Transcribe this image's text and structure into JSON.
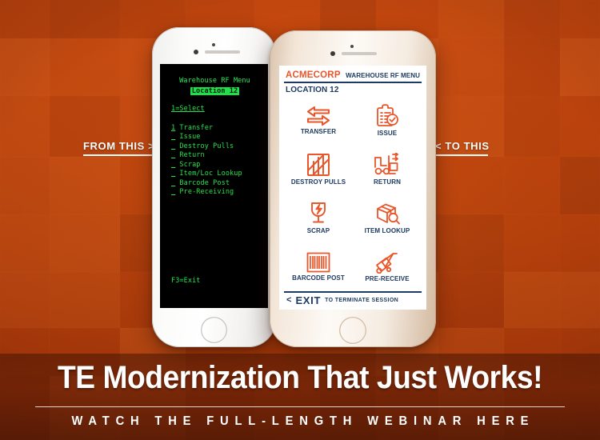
{
  "labels": {
    "from_this": "FROM THIS  >",
    "to_this": "<  TO THIS"
  },
  "legacy_terminal": {
    "title": "Warehouse RF Menu",
    "location": "Location 12",
    "prompt": "1=Select",
    "items": [
      {
        "key": "1",
        "label": "Transfer"
      },
      {
        "key": "_",
        "label": "Issue"
      },
      {
        "key": "_",
        "label": "Destroy Pulls"
      },
      {
        "key": "_",
        "label": "Return"
      },
      {
        "key": "_",
        "label": "Scrap"
      },
      {
        "key": "_",
        "label": "Item/Loc Lookup"
      },
      {
        "key": "_",
        "label": "Barcode Post"
      },
      {
        "key": "_",
        "label": "Pre-Receiving"
      }
    ],
    "exit": "F3=Exit",
    "text_color": "#24e24a",
    "background_color": "#000000"
  },
  "modern_app": {
    "brand": "ACMECORP",
    "header_title": "WAREHOUSE RF MENU",
    "location": "LOCATION 12",
    "tiles": [
      {
        "label": "TRANSFER",
        "icon": "transfer-arrows-icon"
      },
      {
        "label": "ISSUE",
        "icon": "clipboard-check-icon"
      },
      {
        "label": "DESTROY PULLS",
        "icon": "crate-crossed-icon"
      },
      {
        "label": "RETURN",
        "icon": "forklift-icon"
      },
      {
        "label": "SCRAP",
        "icon": "broken-glass-icon"
      },
      {
        "label": "ITEM LOOKUP",
        "icon": "box-magnifier-icon"
      },
      {
        "label": "BARCODE POST",
        "icon": "barcode-icon"
      },
      {
        "label": "PRE-RECEIVE",
        "icon": "hand-truck-icon"
      }
    ],
    "footer": {
      "chevron": "<",
      "exit_label": "EXIT",
      "note": "TO TERMINATE SESSION"
    },
    "accent_color": "#e8562a",
    "text_color": "#1d3a62"
  },
  "banner": {
    "title": "TE Modernization That Just Works!",
    "subtitle": "WATCH THE FULL-LENGTH WEBINAR HERE"
  }
}
